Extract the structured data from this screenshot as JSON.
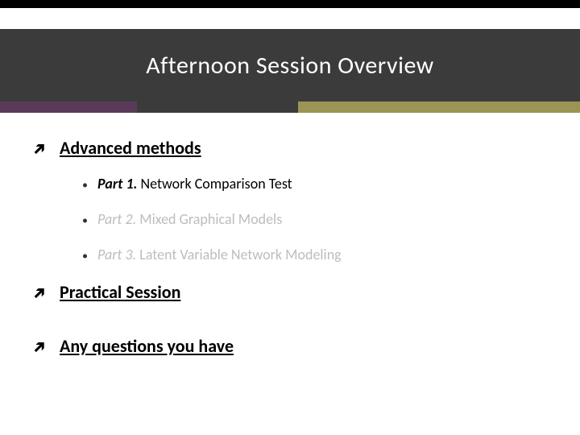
{
  "title": "Afternoon Session Overview",
  "sections": [
    {
      "label": "Advanced methods",
      "items": [
        {
          "part": "Part 1.",
          "text": " Network Comparison Test",
          "active": true
        },
        {
          "part": "Part 2.",
          "text": " Mixed Graphical Models",
          "active": false
        },
        {
          "part": "Part 3.",
          "text": " Latent Variable Network Modeling",
          "active": false
        }
      ]
    },
    {
      "label": "Practical Session",
      "items": []
    },
    {
      "label": "Any questions you have",
      "items": []
    }
  ]
}
